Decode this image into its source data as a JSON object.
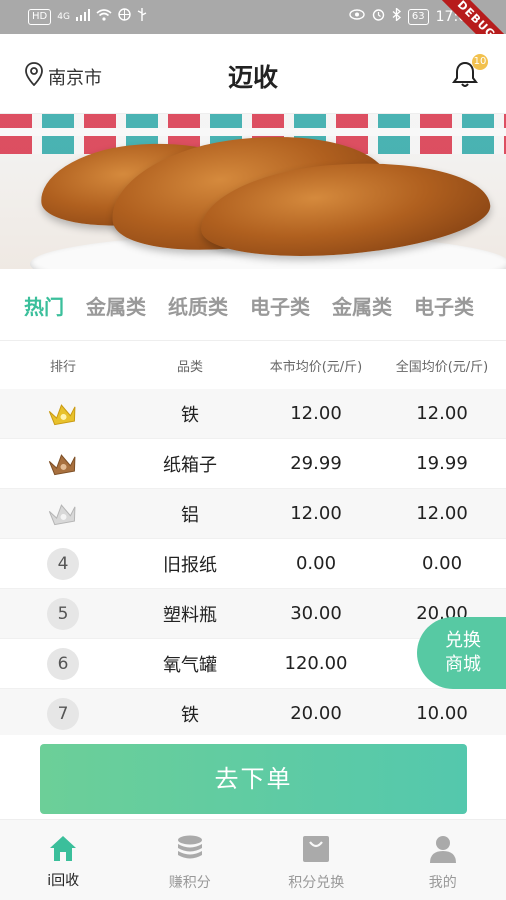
{
  "status_bar": {
    "left_badge": "HD",
    "network": "4G",
    "battery": "63",
    "time": "17:00",
    "debug_label": "DEBUG"
  },
  "header": {
    "location": "南京市",
    "title": "迈收",
    "bell_badge": "10"
  },
  "tabs": [
    "热门",
    "金属类",
    "纸质类",
    "电子类",
    "金属类",
    "电子类"
  ],
  "table": {
    "headers": [
      "排行",
      "品类",
      "本市均价(元/斤)",
      "全国均价(元/斤)"
    ],
    "rows": [
      {
        "rank": "1",
        "name": "铁",
        "local": "12.00",
        "national": "12.00"
      },
      {
        "rank": "2",
        "name": "纸箱子",
        "local": "29.99",
        "national": "19.99"
      },
      {
        "rank": "3",
        "name": "铝",
        "local": "12.00",
        "national": "12.00"
      },
      {
        "rank": "4",
        "name": "旧报纸",
        "local": "0.00",
        "national": "0.00"
      },
      {
        "rank": "5",
        "name": "塑料瓶",
        "local": "30.00",
        "national": "20.00"
      },
      {
        "rank": "6",
        "name": "氧气罐",
        "local": "120.00",
        "national": "1"
      },
      {
        "rank": "7",
        "name": "铁",
        "local": "20.00",
        "national": "10.00"
      }
    ]
  },
  "fab": {
    "line1": "兑换",
    "line2": "商城"
  },
  "order_button": "去下单",
  "bottom_nav": [
    {
      "label": "i回收",
      "icon": "home-icon"
    },
    {
      "label": "赚积分",
      "icon": "coins-icon"
    },
    {
      "label": "积分兑换",
      "icon": "shopping-bag-icon"
    },
    {
      "label": "我的",
      "icon": "user-icon"
    }
  ],
  "colors": {
    "accent": "#3bbf9b",
    "gold": "#e8c12c",
    "bronze": "#a8703e",
    "silver": "#d8d8d8"
  }
}
